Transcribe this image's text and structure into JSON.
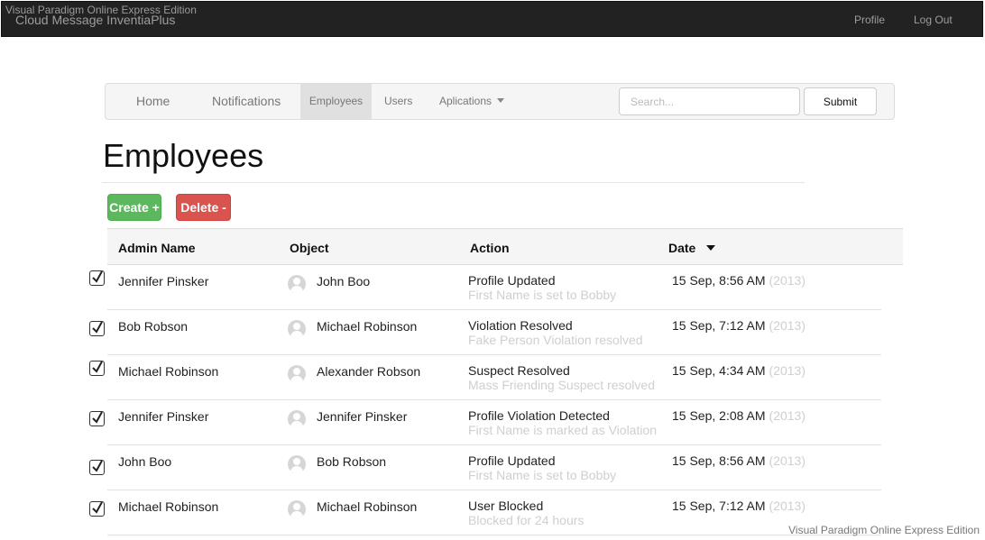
{
  "watermark": "Visual Paradigm Online Express Edition",
  "app": {
    "brand": "Cloud Message InventiaPlus",
    "profile": "Profile",
    "logout": "Log Out"
  },
  "nav": {
    "tabs": [
      "Home",
      "Notifications",
      "Employees",
      "Users",
      "Aplications"
    ],
    "active": "Employees",
    "search_placeholder": "Search...",
    "submit": "Submit"
  },
  "page": {
    "title": "Employees",
    "create": "Create +",
    "delete": "Delete -"
  },
  "table": {
    "columns": [
      "Admin Name",
      "Object",
      "Action",
      "Date"
    ],
    "sorted_by": "Date",
    "rows": [
      {
        "checked": true,
        "admin": "Jennifer Pinsker",
        "object": "John Boo",
        "action": "Profile Updated",
        "detail": "First Name is set to Bobby",
        "date": "15 Sep, 8:56 AM",
        "year": "(2013)"
      },
      {
        "checked": true,
        "admin": "Bob Robson",
        "object": "Michael Robinson",
        "action": "Violation Resolved",
        "detail": "Fake Person Violation resolved",
        "date": "15 Sep, 7:12 AM",
        "year": "(2013)"
      },
      {
        "checked": true,
        "admin": "Michael Robinson",
        "object": "Alexander Robson",
        "action": "Suspect Resolved",
        "detail": "Mass Friending Suspect resolved",
        "date": "15 Sep, 4:34 AM",
        "year": "(2013)"
      },
      {
        "checked": true,
        "admin": "Jennifer Pinsker",
        "object": "Jennifer Pinsker",
        "action": "Profile Violation Detected",
        "detail": "First Name is marked as Violation",
        "date": "15 Sep, 2:08 AM",
        "year": "(2013)"
      },
      {
        "checked": true,
        "admin": "John Boo",
        "object": "Bob Robson",
        "action": "Profile Updated",
        "detail": "First Name is set to Bobby",
        "date": "15 Sep, 8:56 AM",
        "year": "(2013)"
      },
      {
        "checked": true,
        "admin": "Michael Robinson",
        "object": "Michael Robinson",
        "action": "User Blocked",
        "detail": "Blocked for 24 hours",
        "date": "15 Sep, 7:12 AM",
        "year": "(2013)"
      }
    ]
  }
}
